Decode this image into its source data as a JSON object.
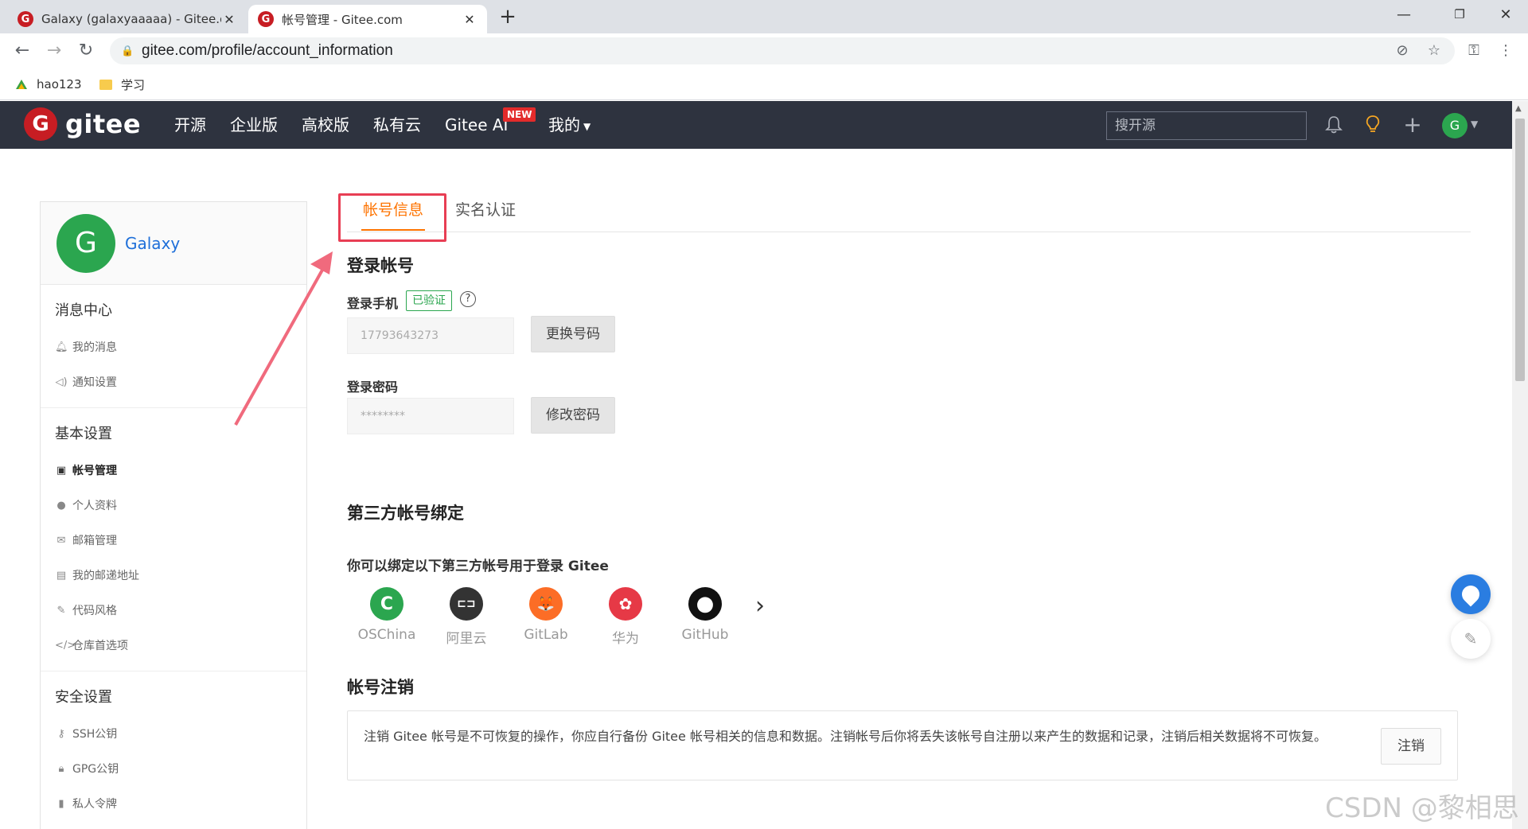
{
  "browser": {
    "tabs": [
      {
        "title": "Galaxy (galaxyaaaaa) - Gitee.co",
        "favicon": "gitee-favicon",
        "close": "✕"
      },
      {
        "title": "帐号管理 - Gitee.com",
        "favicon": "gitee-favicon",
        "close": "✕"
      }
    ],
    "favicon_letter": "G",
    "url": "gitee.com/profile/account_information",
    "bookmarks": [
      {
        "label": "hao123",
        "icon": "hao123-icon"
      },
      {
        "label": "学习",
        "icon": "folder-icon"
      }
    ]
  },
  "header": {
    "logo_letter": "G",
    "logo_text": "gitee",
    "nav": [
      "开源",
      "企业版",
      "高校版",
      "私有云",
      "Gitee AI",
      "我的"
    ],
    "new_badge": "NEW",
    "search_placeholder": "搜开源",
    "avatar_letter": "G"
  },
  "sidebar": {
    "avatar_letter": "G",
    "user_name": "Galaxy",
    "sections": [
      {
        "title": "消息中心",
        "items": [
          {
            "label": "我的消息",
            "icon": "bell-icon"
          },
          {
            "label": "通知设置",
            "icon": "speaker-icon"
          }
        ]
      },
      {
        "title": "基本设置",
        "items": [
          {
            "label": "帐号管理",
            "icon": "id-card-icon",
            "active": true
          },
          {
            "label": "个人资料",
            "icon": "user-icon"
          },
          {
            "label": "邮箱管理",
            "icon": "mail-icon"
          },
          {
            "label": "我的邮递地址",
            "icon": "address-card-icon"
          },
          {
            "label": "代码风格",
            "icon": "brush-icon"
          },
          {
            "label": "仓库首选项",
            "icon": "code-icon"
          }
        ]
      },
      {
        "title": "安全设置",
        "items": [
          {
            "label": "SSH公钥",
            "icon": "key-icon"
          },
          {
            "label": "GPG公钥",
            "icon": "lock-icon"
          },
          {
            "label": "私人令牌",
            "icon": "token-icon"
          }
        ]
      }
    ]
  },
  "main": {
    "tabs": [
      "帐号信息",
      "实名认证"
    ],
    "login_account_title": "登录帐号",
    "phone_label": "登录手机",
    "verified_badge": "已验证",
    "help_mark": "?",
    "phone_value": "17793643273",
    "change_phone_button": "更换号码",
    "password_label": "登录密码",
    "password_value": "********",
    "change_password_button": "修改密码",
    "third_party_title": "第三方帐号绑定",
    "third_party_desc": "你可以绑定以下第三方帐号用于登录 Gitee",
    "providers": [
      {
        "name": "OSChina",
        "color": "#2ba64f",
        "glyph": "C"
      },
      {
        "name": "阿里云",
        "color": "#333333",
        "glyph": "⊏⊐"
      },
      {
        "name": "GitLab",
        "color": "#fc6d26",
        "glyph": "🦊"
      },
      {
        "name": "华为",
        "color": "#e63946",
        "glyph": "✿"
      },
      {
        "name": "GitHub",
        "color": "#111111",
        "glyph": "●"
      }
    ],
    "more_chevron": "›",
    "cancel_title": "帐号注销",
    "cancel_text": "注销 Gitee 帐号是不可恢复的操作，你应自行备份 Gitee 帐号相关的信息和数据。注销帐号后你将丢失该帐号自注册以来产生的数据和记录，注销后相关数据将不可恢复。",
    "cancel_button": "注销"
  },
  "watermark": "CSDN @黎相思",
  "colors": {
    "accent": "#fe7300",
    "header_bg": "#2e333f",
    "brand_red": "#c71d23",
    "avatar_green": "#2ba64f",
    "annotation": "#e83e54"
  }
}
